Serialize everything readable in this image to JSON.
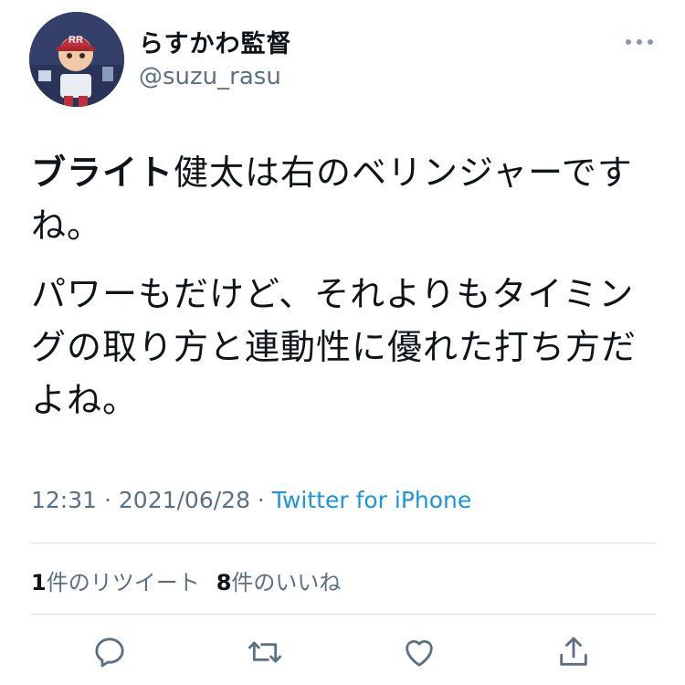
{
  "user": {
    "display_name": "らすかわ監督",
    "handle": "@suzu_rasu",
    "avatar_cap_letters": "RR"
  },
  "tweet": {
    "bold_lead": "ブライト",
    "line1_rest": "健太は右のベリンジャーですね。",
    "paragraph2": "パワーもだけど、それよりもタイミングの取り方と連動性に優れた打ち方だよね。"
  },
  "meta": {
    "time": "12:31",
    "separator": " · ",
    "date": "2021/06/28",
    "source": "Twitter for iPhone"
  },
  "stats": {
    "retweets_count": "1",
    "retweets_label": "件のリツイート",
    "likes_count": "8",
    "likes_label": "件のいいね"
  },
  "icons": {
    "more": "more-horizontal-icon",
    "reply": "reply-icon",
    "retweet": "retweet-icon",
    "like": "like-icon",
    "share": "share-icon"
  },
  "colors": {
    "text": "#0f1419",
    "secondary": "#5b7083",
    "link": "#1b95e0",
    "divider": "#d8dfe5"
  }
}
